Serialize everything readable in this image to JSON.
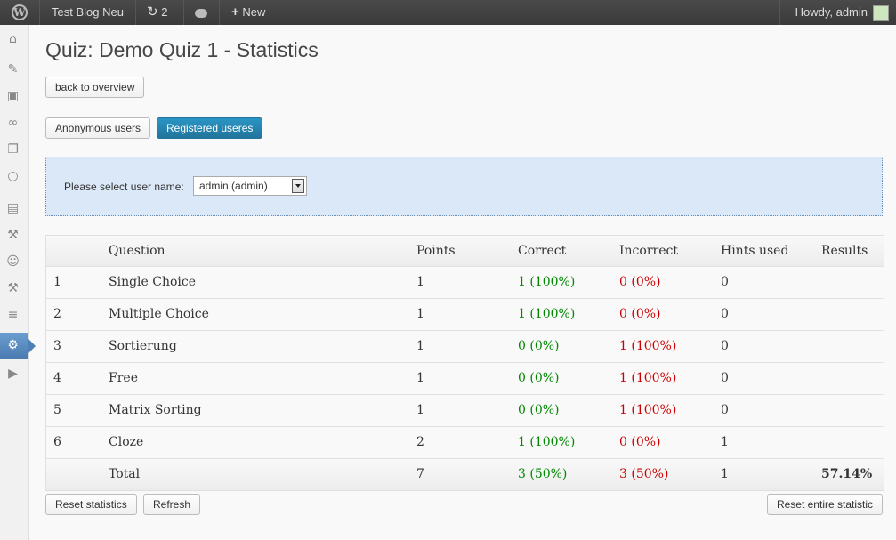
{
  "adminbar": {
    "logo": "W",
    "site_name": "Test Blog Neu",
    "updates_count": "2",
    "new_label": "New",
    "howdy": "Howdy, admin"
  },
  "sidebar": {
    "icons": [
      "dashboard-icon",
      "posts-icon",
      "media-icon",
      "links-icon",
      "pages-icon",
      "comments-icon",
      "appearance-icon",
      "plugins-icon",
      "users-icon",
      "tools-icon",
      "settings-icon",
      "quiz-icon",
      "collapse-icon"
    ]
  },
  "page": {
    "title": "Quiz: Demo Quiz 1 - Statistics",
    "back_button": "back to overview",
    "tabs": [
      "Anonymous users",
      "Registered useres"
    ],
    "select_label": "Please select user name:",
    "select_value": "admin (admin)"
  },
  "table": {
    "headers": {
      "no": "",
      "question": "Question",
      "points": "Points",
      "correct": "Correct",
      "incorrect": "Incorrect",
      "hints": "Hints used",
      "results": "Results"
    },
    "rows": [
      {
        "no": "1",
        "question": "Single Choice",
        "points": "1",
        "correct": "1 (100%)",
        "incorrect": "0 (0%)",
        "hints": "0"
      },
      {
        "no": "2",
        "question": "Multiple Choice",
        "points": "1",
        "correct": "1 (100%)",
        "incorrect": "0 (0%)",
        "hints": "0"
      },
      {
        "no": "3",
        "question": "Sortierung",
        "points": "1",
        "correct": "0 (0%)",
        "incorrect": "1 (100%)",
        "hints": "0"
      },
      {
        "no": "4",
        "question": "Free",
        "points": "1",
        "correct": "0 (0%)",
        "incorrect": "1 (100%)",
        "hints": "0"
      },
      {
        "no": "5",
        "question": "Matrix Sorting",
        "points": "1",
        "correct": "0 (0%)",
        "incorrect": "1 (100%)",
        "hints": "0"
      },
      {
        "no": "6",
        "question": "Cloze",
        "points": "2",
        "correct": "1 (100%)",
        "incorrect": "0 (0%)",
        "hints": "1"
      }
    ],
    "total": {
      "label": "Total",
      "points": "7",
      "correct": "3 (50%)",
      "incorrect": "3 (50%)",
      "hints": "1",
      "result": "57.14%"
    }
  },
  "buttons": {
    "reset": "Reset statistics",
    "refresh": "Refresh",
    "reset_all": "Reset entire statistic"
  },
  "colors": {
    "correct": "#008800",
    "incorrect": "#cc0000",
    "primary": "#21759b"
  }
}
